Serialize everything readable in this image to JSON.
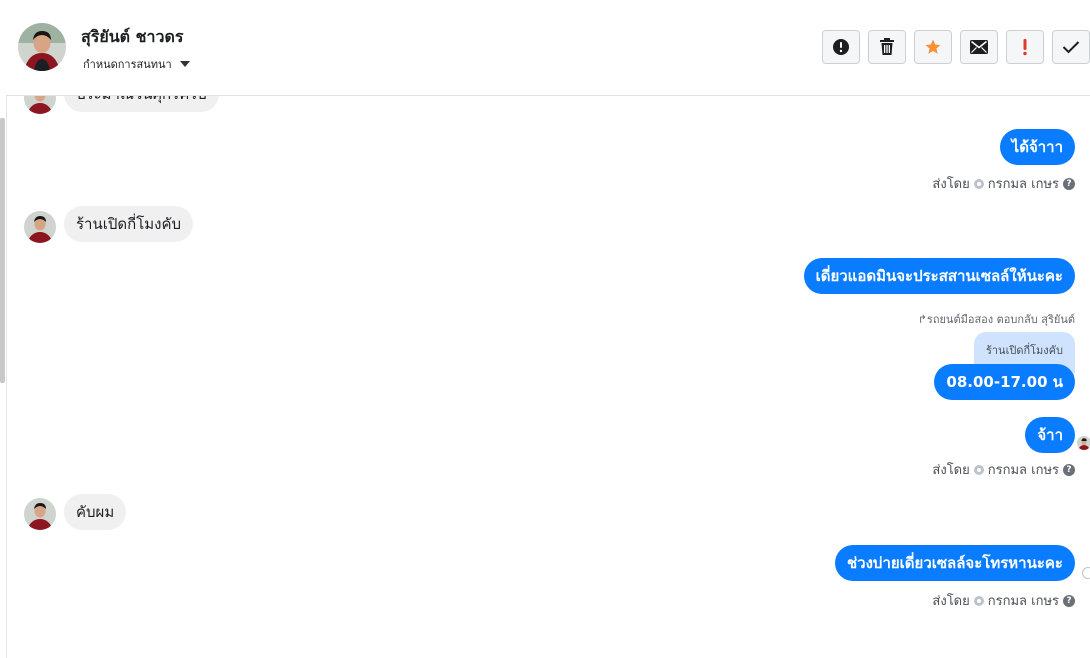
{
  "header": {
    "name": "สุริยันต์ ชาวดร",
    "subtitle": "กำหนดการสนทนา"
  },
  "actions": [
    {
      "name": "report-spam-icon"
    },
    {
      "name": "trash-icon"
    },
    {
      "name": "star-icon",
      "color": "#f7923a"
    },
    {
      "name": "mail-icon"
    },
    {
      "name": "important-icon",
      "color": "#e03a2e"
    },
    {
      "name": "check-icon"
    }
  ],
  "messages": {
    "in_top_partial": "ประมาณวันศุกร์ครับ",
    "out_1": "ได้จ้าาา",
    "meta_1": {
      "prefix": "ส่งโดย",
      "agent": "กรกมล เกษร"
    },
    "in_2": "ร้านเปิดกี่โมงคับ",
    "out_2": "เดี่ยวแอดมินจะประสสานเซลล์ให้นะคะ",
    "reply_note": "รถยนต์มือสอง ตอบกลับ สุริยันต์",
    "quote": "ร้านเปิดกี่โมงคับ",
    "out_3": "08.00-17.00 น",
    "out_4": "จ้าา",
    "meta_2": {
      "prefix": "ส่งโดย",
      "agent": "กรกมล เกษร"
    },
    "in_3": "คับผม",
    "out_5": "ช่วงบ่ายเดี่ยวเซลล์จะโทรหานะคะ",
    "meta_3": {
      "prefix": "ส่งโดย",
      "agent": "กรกมล เกษร"
    }
  },
  "colors": {
    "outgoing": "#0a7cff",
    "incoming": "#f1f0f0",
    "quote": "#cfe3ff"
  }
}
